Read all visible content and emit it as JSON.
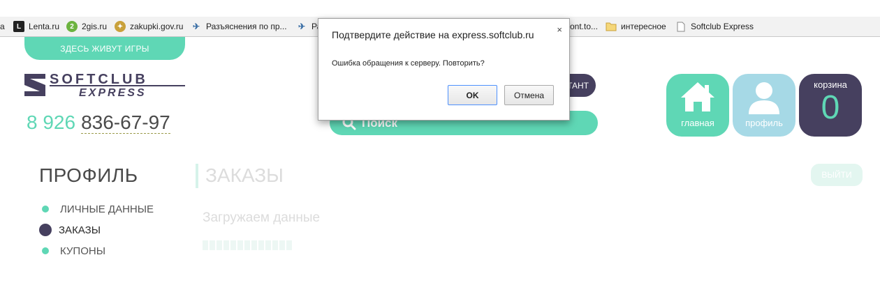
{
  "bookmarks": [
    {
      "label": "а",
      "icon": "bookmark-fragment"
    },
    {
      "label": "Lenta.ru",
      "icon": "lenta-icon"
    },
    {
      "label": "2gis.ru",
      "icon": "2gis-icon"
    },
    {
      "label": "zakupki.gov.ru",
      "icon": "coat-of-arms-icon"
    },
    {
      "label": "Разъяснения по пр...",
      "icon": "consultant-icon"
    },
    {
      "label": "Ра",
      "icon": "consultant-icon"
    },
    {
      "label": "ont.to...",
      "icon": "page-icon"
    },
    {
      "label": "интересное",
      "icon": "folder-icon"
    },
    {
      "label": "Softclub Express",
      "icon": "page-icon"
    }
  ],
  "header": {
    "tagline": "ЗДЕСЬ ЖИВУТ ИГРЫ",
    "logo_top": "SOFTCLUB",
    "logo_bottom": "EXPRESS",
    "phone_code": "8 926",
    "phone_number": "836-67-97",
    "consult_label": "ТАНТ",
    "search_placeholder": "Поиск",
    "home_label": "главная",
    "profile_label": "профиль",
    "cart_label": "корзина",
    "cart_count": "0"
  },
  "sidebar": {
    "title": "ПРОФИЛЬ",
    "items": [
      {
        "label": "ЛИЧНЫЕ ДАННЫЕ",
        "active": false
      },
      {
        "label": "ЗАКАЗЫ",
        "active": true
      },
      {
        "label": "КУПОНЫ",
        "active": false
      }
    ]
  },
  "orders": {
    "title": "ЗАКАЗЫ",
    "logout_label": "ВЫЙТИ",
    "loading_text": "Загружаем данные",
    "loading_progress": 0
  },
  "dialog": {
    "title": "Подтвердите действие на express.softclub.ru",
    "message": "Ошибка обращения к серверу. Повторить?",
    "ok_label": "OK",
    "cancel_label": "Отмена",
    "close_glyph": "×"
  },
  "colors": {
    "accent": "#5fd7b5",
    "dark": "#46405f",
    "profile_tile": "#a6d9e6"
  }
}
